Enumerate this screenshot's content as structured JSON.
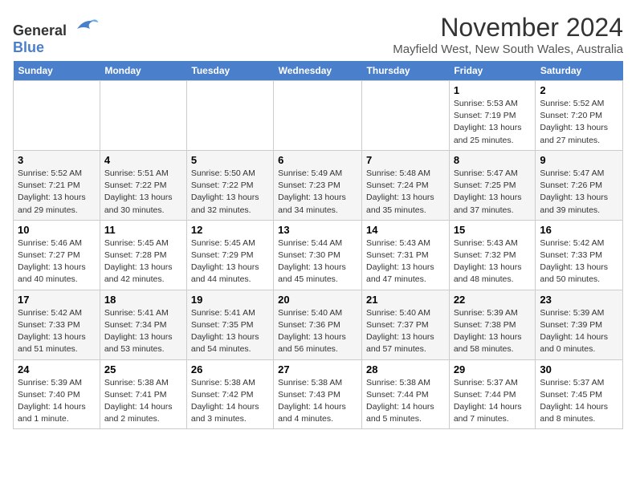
{
  "logo": {
    "general": "General",
    "blue": "Blue"
  },
  "header": {
    "month": "November 2024",
    "location": "Mayfield West, New South Wales, Australia"
  },
  "weekdays": [
    "Sunday",
    "Monday",
    "Tuesday",
    "Wednesday",
    "Thursday",
    "Friday",
    "Saturday"
  ],
  "weeks": [
    [
      {
        "day": "",
        "info": ""
      },
      {
        "day": "",
        "info": ""
      },
      {
        "day": "",
        "info": ""
      },
      {
        "day": "",
        "info": ""
      },
      {
        "day": "",
        "info": ""
      },
      {
        "day": "1",
        "info": "Sunrise: 5:53 AM\nSunset: 7:19 PM\nDaylight: 13 hours\nand 25 minutes."
      },
      {
        "day": "2",
        "info": "Sunrise: 5:52 AM\nSunset: 7:20 PM\nDaylight: 13 hours\nand 27 minutes."
      }
    ],
    [
      {
        "day": "3",
        "info": "Sunrise: 5:52 AM\nSunset: 7:21 PM\nDaylight: 13 hours\nand 29 minutes."
      },
      {
        "day": "4",
        "info": "Sunrise: 5:51 AM\nSunset: 7:22 PM\nDaylight: 13 hours\nand 30 minutes."
      },
      {
        "day": "5",
        "info": "Sunrise: 5:50 AM\nSunset: 7:22 PM\nDaylight: 13 hours\nand 32 minutes."
      },
      {
        "day": "6",
        "info": "Sunrise: 5:49 AM\nSunset: 7:23 PM\nDaylight: 13 hours\nand 34 minutes."
      },
      {
        "day": "7",
        "info": "Sunrise: 5:48 AM\nSunset: 7:24 PM\nDaylight: 13 hours\nand 35 minutes."
      },
      {
        "day": "8",
        "info": "Sunrise: 5:47 AM\nSunset: 7:25 PM\nDaylight: 13 hours\nand 37 minutes."
      },
      {
        "day": "9",
        "info": "Sunrise: 5:47 AM\nSunset: 7:26 PM\nDaylight: 13 hours\nand 39 minutes."
      }
    ],
    [
      {
        "day": "10",
        "info": "Sunrise: 5:46 AM\nSunset: 7:27 PM\nDaylight: 13 hours\nand 40 minutes."
      },
      {
        "day": "11",
        "info": "Sunrise: 5:45 AM\nSunset: 7:28 PM\nDaylight: 13 hours\nand 42 minutes."
      },
      {
        "day": "12",
        "info": "Sunrise: 5:45 AM\nSunset: 7:29 PM\nDaylight: 13 hours\nand 44 minutes."
      },
      {
        "day": "13",
        "info": "Sunrise: 5:44 AM\nSunset: 7:30 PM\nDaylight: 13 hours\nand 45 minutes."
      },
      {
        "day": "14",
        "info": "Sunrise: 5:43 AM\nSunset: 7:31 PM\nDaylight: 13 hours\nand 47 minutes."
      },
      {
        "day": "15",
        "info": "Sunrise: 5:43 AM\nSunset: 7:32 PM\nDaylight: 13 hours\nand 48 minutes."
      },
      {
        "day": "16",
        "info": "Sunrise: 5:42 AM\nSunset: 7:33 PM\nDaylight: 13 hours\nand 50 minutes."
      }
    ],
    [
      {
        "day": "17",
        "info": "Sunrise: 5:42 AM\nSunset: 7:33 PM\nDaylight: 13 hours\nand 51 minutes."
      },
      {
        "day": "18",
        "info": "Sunrise: 5:41 AM\nSunset: 7:34 PM\nDaylight: 13 hours\nand 53 minutes."
      },
      {
        "day": "19",
        "info": "Sunrise: 5:41 AM\nSunset: 7:35 PM\nDaylight: 13 hours\nand 54 minutes."
      },
      {
        "day": "20",
        "info": "Sunrise: 5:40 AM\nSunset: 7:36 PM\nDaylight: 13 hours\nand 56 minutes."
      },
      {
        "day": "21",
        "info": "Sunrise: 5:40 AM\nSunset: 7:37 PM\nDaylight: 13 hours\nand 57 minutes."
      },
      {
        "day": "22",
        "info": "Sunrise: 5:39 AM\nSunset: 7:38 PM\nDaylight: 13 hours\nand 58 minutes."
      },
      {
        "day": "23",
        "info": "Sunrise: 5:39 AM\nSunset: 7:39 PM\nDaylight: 14 hours\nand 0 minutes."
      }
    ],
    [
      {
        "day": "24",
        "info": "Sunrise: 5:39 AM\nSunset: 7:40 PM\nDaylight: 14 hours\nand 1 minute."
      },
      {
        "day": "25",
        "info": "Sunrise: 5:38 AM\nSunset: 7:41 PM\nDaylight: 14 hours\nand 2 minutes."
      },
      {
        "day": "26",
        "info": "Sunrise: 5:38 AM\nSunset: 7:42 PM\nDaylight: 14 hours\nand 3 minutes."
      },
      {
        "day": "27",
        "info": "Sunrise: 5:38 AM\nSunset: 7:43 PM\nDaylight: 14 hours\nand 4 minutes."
      },
      {
        "day": "28",
        "info": "Sunrise: 5:38 AM\nSunset: 7:44 PM\nDaylight: 14 hours\nand 5 minutes."
      },
      {
        "day": "29",
        "info": "Sunrise: 5:37 AM\nSunset: 7:44 PM\nDaylight: 14 hours\nand 7 minutes."
      },
      {
        "day": "30",
        "info": "Sunrise: 5:37 AM\nSunset: 7:45 PM\nDaylight: 14 hours\nand 8 minutes."
      }
    ]
  ]
}
